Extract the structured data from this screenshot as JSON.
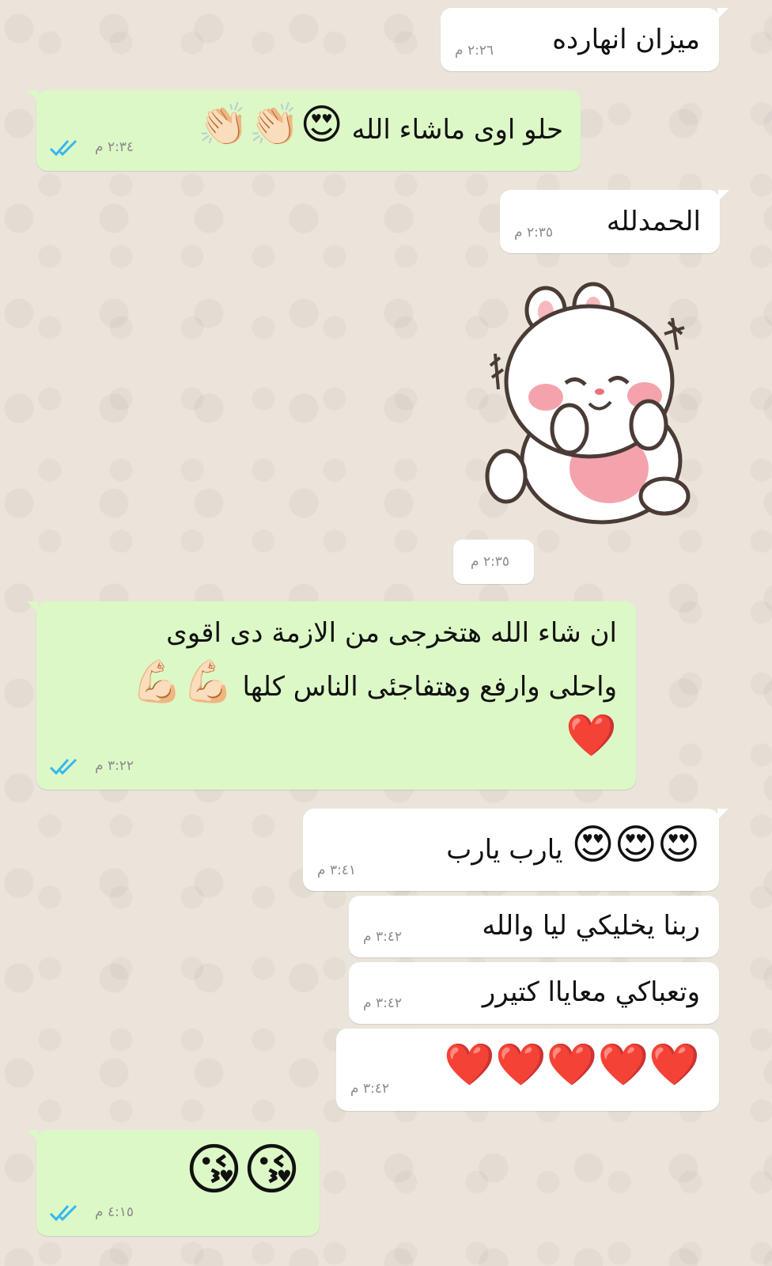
{
  "messages": [
    {
      "id": "m1",
      "direction": "incoming",
      "text": "ميزان انهارده",
      "time": "٢:٢٦ م"
    },
    {
      "id": "m2",
      "direction": "outgoing",
      "text": "حلو اوى ماشاء الله",
      "emojis": [
        "😍",
        "👏🏻",
        "👏🏻"
      ],
      "time": "٢:٣٤ م",
      "status": "read"
    },
    {
      "id": "m3",
      "direction": "incoming",
      "text": "الحمدلله",
      "time": "٢:٣٥ م"
    },
    {
      "id": "m4",
      "direction": "incoming",
      "type": "sticker",
      "sticker": "bunny-sticker",
      "time": "٢:٣٥ م"
    },
    {
      "id": "m5",
      "direction": "outgoing",
      "lines": [
        "ان شاء الله هتخرجى من الازمة دى اقوى",
        "واحلى وارفع وهتفاجئى الناس كلها"
      ],
      "emojis": [
        "💪🏻",
        "💪🏻",
        "❤️"
      ],
      "time": "٣:٢٢ م",
      "status": "read"
    },
    {
      "id": "m6",
      "direction": "incoming",
      "text": "يارب يارب",
      "emojis": [
        "😍",
        "😍",
        "😍"
      ],
      "time": "٣:٤١ م"
    },
    {
      "id": "m7",
      "direction": "incoming",
      "text": "ربنا يخليكي ليا والله",
      "time": "٣:٤٢ م"
    },
    {
      "id": "m8",
      "direction": "incoming",
      "text": "وتعباكي معاياا كتيرر",
      "time": "٣:٤٢ م"
    },
    {
      "id": "m9",
      "direction": "incoming",
      "emojis": [
        "❤️",
        "❤️",
        "❤️",
        "❤️",
        "❤️"
      ],
      "time": "٣:٤٢ م"
    },
    {
      "id": "m10",
      "direction": "outgoing",
      "emojis": [
        "😘",
        "😘"
      ],
      "time": "٤:١٥ م",
      "status": "read"
    }
  ],
  "colors": {
    "incoming_bubble": "#ffffff",
    "outgoing_bubble": "#dcf8c6",
    "read_ticks": "#34b7f1",
    "background": "#ece5dd"
  }
}
